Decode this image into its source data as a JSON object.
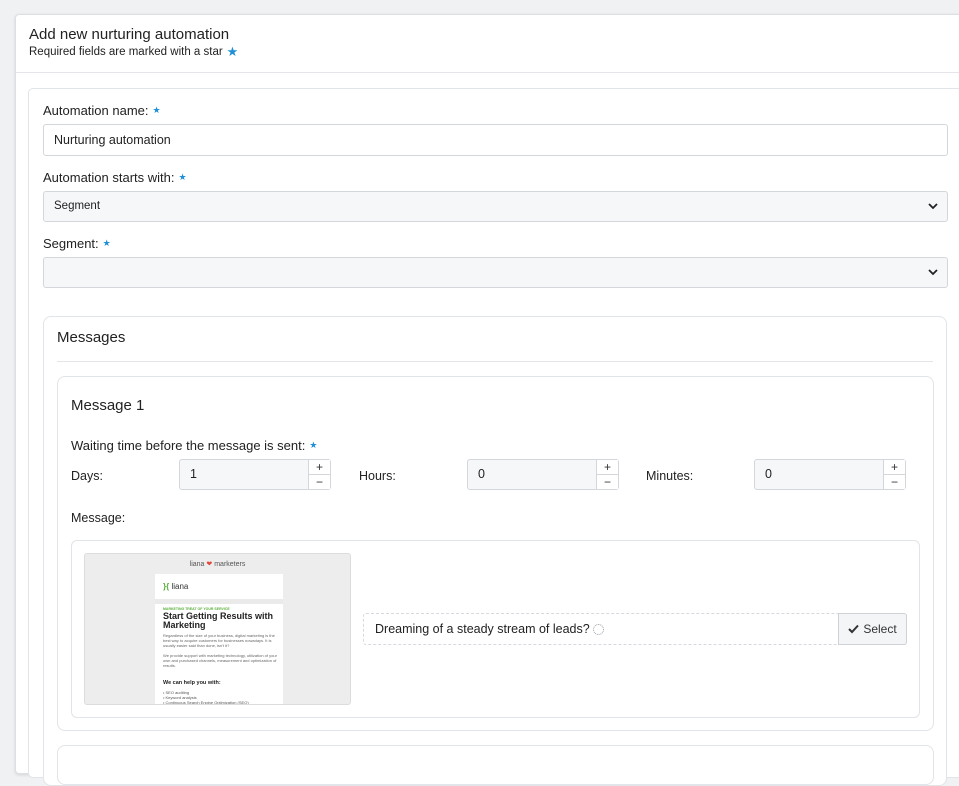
{
  "header": {
    "title": "Add new nurturing automation",
    "subtitle": "Required fields are marked with a star"
  },
  "form": {
    "automation_name": {
      "label": "Automation name:",
      "value": "Nurturing automation"
    },
    "starts_with": {
      "label": "Automation starts with:",
      "value": "Segment"
    },
    "segment": {
      "label": "Segment:",
      "value": ""
    }
  },
  "messages": {
    "title": "Messages",
    "items": [
      {
        "title": "Message 1",
        "waiting_label": "Waiting time before the message is sent:",
        "days": {
          "label": "Days:",
          "value": "1"
        },
        "hours": {
          "label": "Hours:",
          "value": "0"
        },
        "minutes": {
          "label": "Minutes:",
          "value": "0"
        },
        "message_label": "Message:",
        "selected_message": "Dreaming of a steady stream of leads?",
        "select_button": "Select",
        "preview": {
          "header": "liana",
          "header_tail": "marketers",
          "logo": "liana",
          "kicker": "MARKETING TREAT OF YOUR SERVICE",
          "headline": "Start Getting Results with Marketing",
          "para1": "Regardless of the size of your business, digital marketing is the best way to acquire customers for businesses nowadays. It is usually easier said than done, isn't it?",
          "para2": "We provide support with marketing technology, utilization of your own and purchased channels, measurement and optimization of results.",
          "subheading": "We can help you with:",
          "list": [
            "SEO auditing",
            "Keyword analysis",
            "Continuous Search Engine Optimization (SEO)"
          ]
        }
      }
    ]
  },
  "colors": {
    "required_star": "#1f8fd6",
    "border": "#d3d6db"
  }
}
